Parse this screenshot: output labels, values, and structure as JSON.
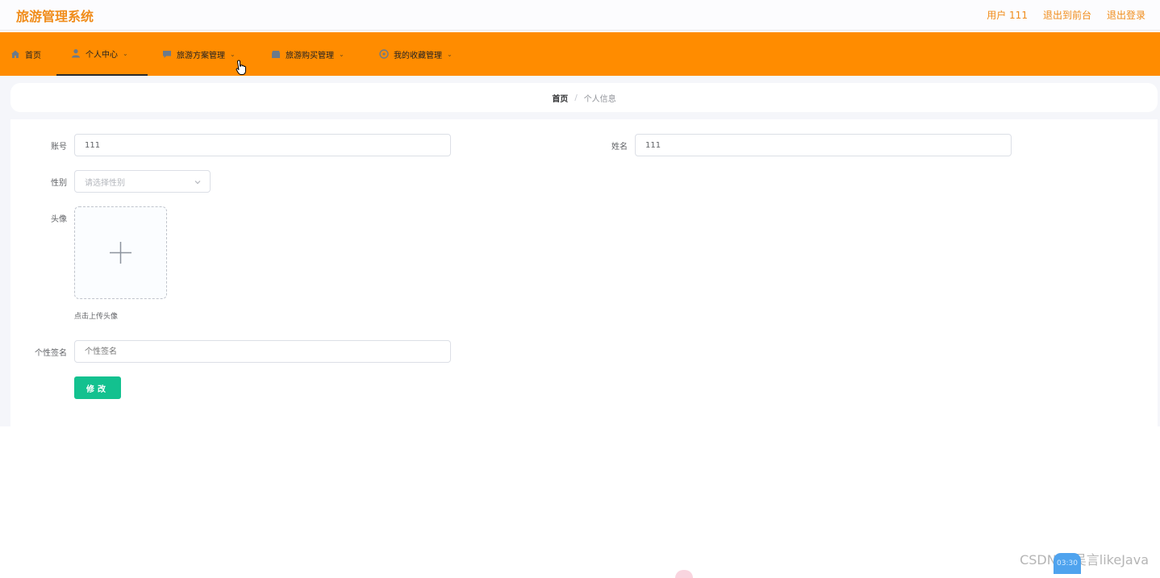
{
  "header": {
    "brand": "旅游管理系统",
    "user_label": "用户 111",
    "back_to_front": "退出到前台",
    "logout": "退出登录"
  },
  "nav": {
    "items": [
      {
        "label": "首页",
        "icon": "home-icon"
      },
      {
        "label": "个人中心",
        "icon": "user-icon",
        "active": true
      },
      {
        "label": "旅游方案管理",
        "icon": "chat-icon"
      },
      {
        "label": "旅游购买管理",
        "icon": "shop-icon"
      },
      {
        "label": "我的收藏管理",
        "icon": "star-icon"
      }
    ]
  },
  "breadcrumb": {
    "home": "首页",
    "separator": "/",
    "current": "个人信息"
  },
  "form": {
    "account_label": "账号",
    "account_value": "111",
    "name_label": "姓名",
    "name_value": "111",
    "gender_label": "性别",
    "gender_placeholder": "请选择性别",
    "avatar_label": "头像",
    "avatar_hint": "点击上传头像",
    "signature_label": "个性签名",
    "signature_placeholder": "个性签名",
    "submit_label": "修改"
  },
  "overlay": {
    "watermark": "CSDN @吴言likeJava",
    "badge": "03:30"
  },
  "colors": {
    "brand": "#f08c1a",
    "nav_bg": "#ff8c00",
    "submit": "#13c18f"
  }
}
